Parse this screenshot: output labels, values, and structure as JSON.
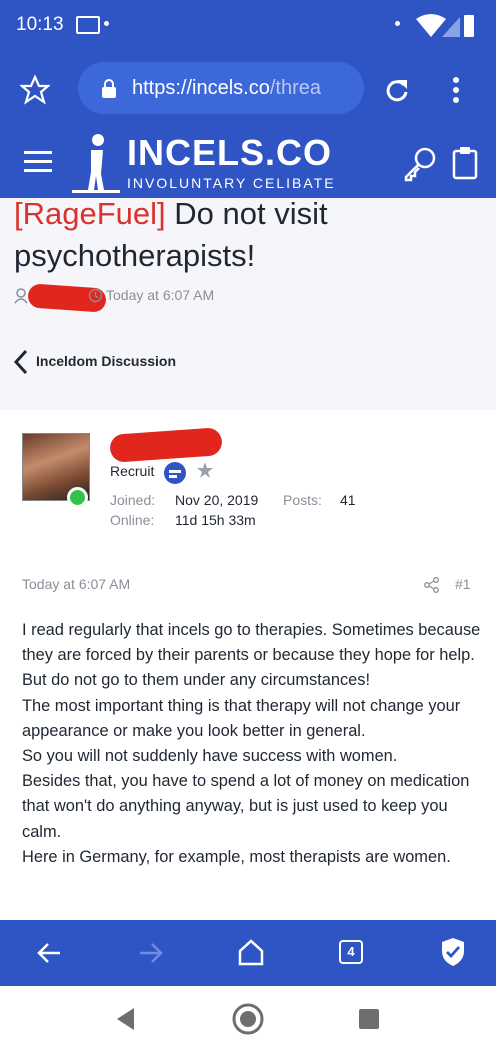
{
  "status_bar": {
    "time": "10:13"
  },
  "browser": {
    "url_host": "https://incels.co",
    "url_path": "/threa"
  },
  "site": {
    "name": "INCELS.CO",
    "tagline": "INVOLUNTARY CELIBATE"
  },
  "thread": {
    "prefix": "[RageFuel]",
    "title": "Do not visit psychotherapists!",
    "date": "Today at 6:07 AM",
    "breadcrumb": "Inceldom Discussion"
  },
  "post": {
    "rank": "Recruit",
    "joined_label": "Joined:",
    "joined_value": "Nov 20, 2019",
    "posts_label": "Posts:",
    "posts_value": "41",
    "online_label": "Online:",
    "online_value": "11d 15h 33m",
    "date": "Today at 6:07 AM",
    "number": "#1",
    "paragraphs": [
      "I read regularly that incels go to therapies. Sometimes because they are forced by their parents or because they hope for help.",
      "But do not go to them under any circumstances!",
      "The most important thing is that therapy will not change your appearance or make you look better in general.",
      "So you will not suddenly have success with women.",
      "Besides that, you have to spend a lot of money on medication that won't do anything anyway, but is just used to keep you calm.",
      "Here in Germany, for example, most therapists are women."
    ]
  },
  "bottom_bar": {
    "tab_count": "4"
  },
  "colors": {
    "brand": "#2f55c5",
    "prefix": "#d8332f",
    "online": "#33c24a"
  }
}
